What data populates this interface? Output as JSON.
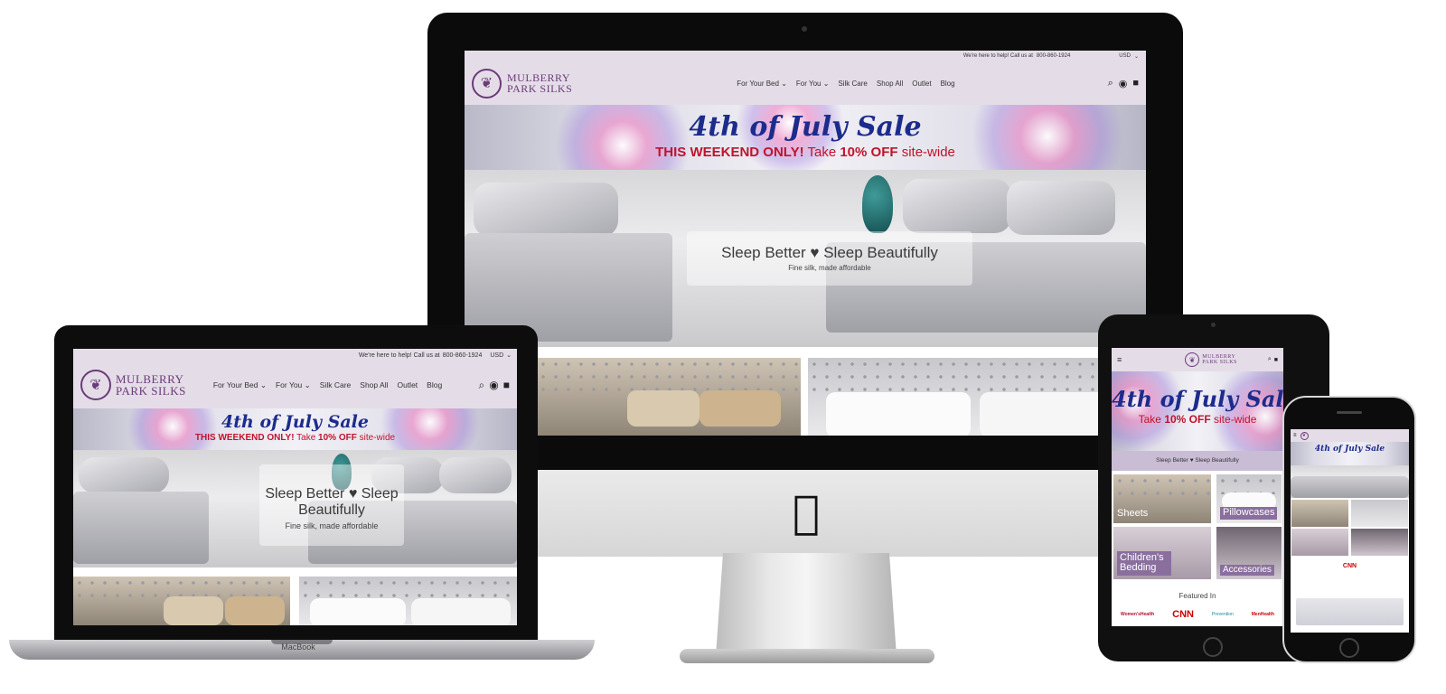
{
  "topbar": {
    "help_text": "We're here to help! Call us at ",
    "phone": "800-860-1924",
    "currency": "USD"
  },
  "brand": {
    "line1": "MULBERRY",
    "line2": "PARK SILKS"
  },
  "nav": {
    "items": [
      "For Your Bed",
      "For You",
      "Silk Care",
      "Shop All",
      "Outlet",
      "Blog"
    ],
    "chevron": "▾"
  },
  "icons": {
    "search": "search-icon",
    "account": "account-icon",
    "cart": "cart-icon",
    "menu": "hamburger-menu-icon",
    "apple": "apple-logo"
  },
  "banner": {
    "title": "4th of July Sale",
    "weekend": "THIS WEEKEND ONLY!",
    "take": "Take",
    "discount": "10% OFF",
    "sitewide": "site-wide"
  },
  "hero": {
    "title": "Sleep Better ♥ Sleep Beautifully",
    "title_line1": "Sleep Better ♥ Sleep",
    "title_line2": "Beautifully",
    "subtitle": "Fine silk, made affordable",
    "bar_text": "Sleep Better ♥ Sleep Beautifully"
  },
  "categories": [
    "Sheets",
    "Pillowcases",
    "Children's Bedding",
    "Accessories"
  ],
  "featured": {
    "heading": "Featured In",
    "outlets": [
      "Women'sHealth",
      "CNN",
      "Prevention",
      "MenHealth"
    ]
  },
  "laptop_label": "MacBook",
  "colors": {
    "nav_bg": "#e4dde8",
    "brand_purple": "#6b3a78",
    "sale_blue": "#1c2c8c",
    "sale_red": "#c1122c",
    "cat_label_bg": "#8a6f9e"
  }
}
